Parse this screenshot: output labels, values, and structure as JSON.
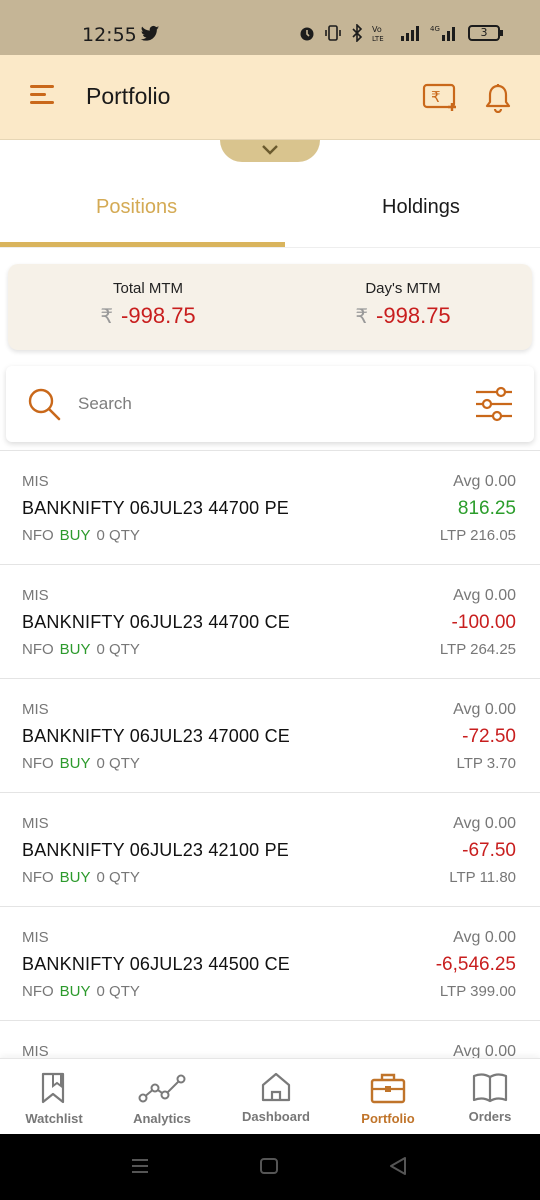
{
  "status_bar": {
    "time": "12:55",
    "battery": "3"
  },
  "header": {
    "title": "Portfolio"
  },
  "tabs": [
    {
      "label": "Positions",
      "active": true
    },
    {
      "label": "Holdings",
      "active": false
    }
  ],
  "mtm": {
    "total_label": "Total MTM",
    "total_currency": "₹",
    "total_value": "-998.75",
    "day_label": "Day's MTM",
    "day_currency": "₹",
    "day_value": "-998.75"
  },
  "search": {
    "placeholder": "Search"
  },
  "positions": [
    {
      "product": "MIS",
      "symbol": "BANKNIFTY 06JUL23 44700 PE",
      "exchange": "NFO",
      "side": "BUY",
      "qty": "0",
      "qty_label": "QTY",
      "avg": "Avg  0.00",
      "pnl": "816.25",
      "ltp": "LTP 216.05"
    },
    {
      "product": "MIS",
      "symbol": "BANKNIFTY 06JUL23 44700 CE",
      "exchange": "NFO",
      "side": "BUY",
      "qty": "0",
      "qty_label": "QTY",
      "avg": "Avg  0.00",
      "pnl": "-100.00",
      "ltp": "LTP 264.25"
    },
    {
      "product": "MIS",
      "symbol": "BANKNIFTY 06JUL23 47000 CE",
      "exchange": "NFO",
      "side": "BUY",
      "qty": "0",
      "qty_label": "QTY",
      "avg": "Avg  0.00",
      "pnl": "-72.50",
      "ltp": "LTP 3.70"
    },
    {
      "product": "MIS",
      "symbol": "BANKNIFTY 06JUL23 42100 PE",
      "exchange": "NFO",
      "side": "BUY",
      "qty": "0",
      "qty_label": "QTY",
      "avg": "Avg  0.00",
      "pnl": "-67.50",
      "ltp": "LTP 11.80"
    },
    {
      "product": "MIS",
      "symbol": "BANKNIFTY 06JUL23 44500 CE",
      "exchange": "NFO",
      "side": "BUY",
      "qty": "0",
      "qty_label": "QTY",
      "avg": "Avg  0.00",
      "pnl": "-6,546.25",
      "ltp": "LTP 399.00"
    },
    {
      "product": "MIS",
      "symbol": "",
      "exchange": "",
      "side": "",
      "qty": "",
      "qty_label": "",
      "avg": "Avg  0.00",
      "pnl": "",
      "ltp": ""
    }
  ],
  "bottom_nav": [
    {
      "label": "Watchlist",
      "icon": "bookmark-icon",
      "active": false
    },
    {
      "label": "Analytics",
      "icon": "analytics-icon",
      "active": false
    },
    {
      "label": "Dashboard",
      "icon": "home-icon",
      "active": false
    },
    {
      "label": "Portfolio",
      "icon": "briefcase-icon",
      "active": true
    },
    {
      "label": "Orders",
      "icon": "book-icon",
      "active": false
    }
  ],
  "colors": {
    "accent": "#d9b45d",
    "header_bg": "#fbe9c8",
    "positive": "#2b9d2b",
    "negative": "#c81e1e",
    "active_nav": "#c0742a"
  }
}
